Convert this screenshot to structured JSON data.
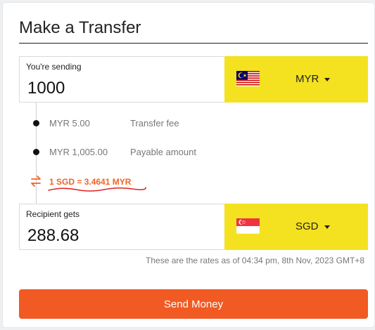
{
  "title": "Make a Transfer",
  "sending": {
    "label": "You're sending",
    "amount": "1000",
    "currency": "MYR",
    "flag": "malaysia-flag"
  },
  "breakdown": {
    "fee_amount": "MYR 5.00",
    "fee_label": "Transfer fee",
    "payable_amount": "MYR 1,005.00",
    "payable_label": "Payable amount",
    "rate": "1 SGD = 3.4641 MYR"
  },
  "receiving": {
    "label": "Recipient gets",
    "amount": "288.68",
    "currency": "SGD",
    "flag": "singapore-flag"
  },
  "rates_note": "These are the rates as of 04:34 pm, 8th Nov, 2023 GMT+8",
  "send_button": "Send Money",
  "colors": {
    "accent": "#f15a22",
    "currency_bg": "#f4e11f",
    "rate_text": "#f26322"
  }
}
